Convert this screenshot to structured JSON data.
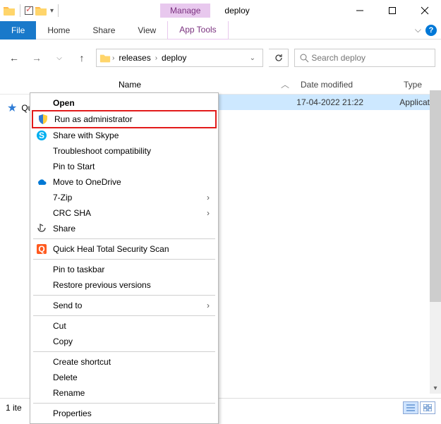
{
  "window": {
    "title": "deploy",
    "manage_tab": "Manage"
  },
  "ribbon": {
    "file": "File",
    "tabs": [
      "Home",
      "Share",
      "View"
    ],
    "apptools": "App Tools"
  },
  "nav": {
    "crumbs": [
      "releases",
      "deploy"
    ]
  },
  "search": {
    "placeholder": "Search deploy"
  },
  "columns": {
    "name": "Name",
    "date": "Date modified",
    "type": "Type"
  },
  "side": {
    "quick": "Quick access"
  },
  "rows": [
    {
      "name": "",
      "date": "17-04-2022 21:22",
      "type": "Application"
    }
  ],
  "ctx": {
    "open": "Open",
    "run_admin": "Run as administrator",
    "skype": "Share with Skype",
    "troubleshoot": "Troubleshoot compatibility",
    "pin_start": "Pin to Start",
    "onedrive": "Move to OneDrive",
    "sevenzip": "7-Zip",
    "crc": "CRC SHA",
    "share": "Share",
    "quickheal": "Quick Heal Total Security Scan",
    "pin_taskbar": "Pin to taskbar",
    "restore": "Restore previous versions",
    "send": "Send to",
    "cut": "Cut",
    "copy": "Copy",
    "shortcut": "Create shortcut",
    "delete": "Delete",
    "rename": "Rename",
    "props": "Properties"
  },
  "status": {
    "count": "1 ite"
  }
}
